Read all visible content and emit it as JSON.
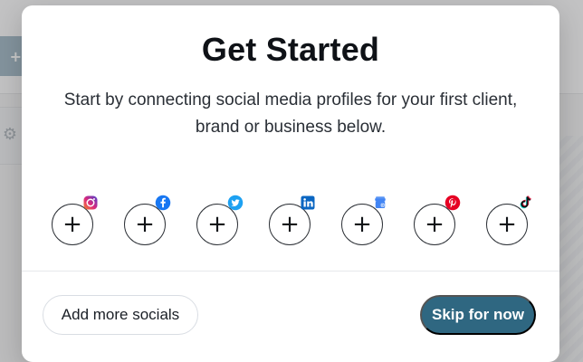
{
  "background": {
    "left_button_label": "+",
    "gear_icon": "gear-icon"
  },
  "modal": {
    "title": "Get Started",
    "subtitle": "Start by connecting social media profiles for your first client, brand or business below.",
    "socials": [
      {
        "key": "instagram",
        "plus": "+",
        "icon": "instagram-icon",
        "brand_color": "#E1306C"
      },
      {
        "key": "facebook",
        "plus": "+",
        "icon": "facebook-icon",
        "brand_color": "#1877F2"
      },
      {
        "key": "twitter",
        "plus": "+",
        "icon": "twitter-icon",
        "brand_color": "#1DA1F2"
      },
      {
        "key": "linkedin",
        "plus": "+",
        "icon": "linkedin-icon",
        "brand_color": "#0A66C2"
      },
      {
        "key": "google-business",
        "plus": "+",
        "icon": "google-business-icon",
        "brand_color": "#4285F4"
      },
      {
        "key": "pinterest",
        "plus": "+",
        "icon": "pinterest-icon",
        "brand_color": "#E60023"
      },
      {
        "key": "tiktok",
        "plus": "+",
        "icon": "tiktok-icon",
        "brand_color": "#000000"
      }
    ],
    "buttons": {
      "add_more_label": "Add more socials",
      "skip_label": "Skip for now"
    },
    "colors": {
      "primary": "#2F6781",
      "overlay": "rgba(120,120,120,0.40)"
    }
  }
}
